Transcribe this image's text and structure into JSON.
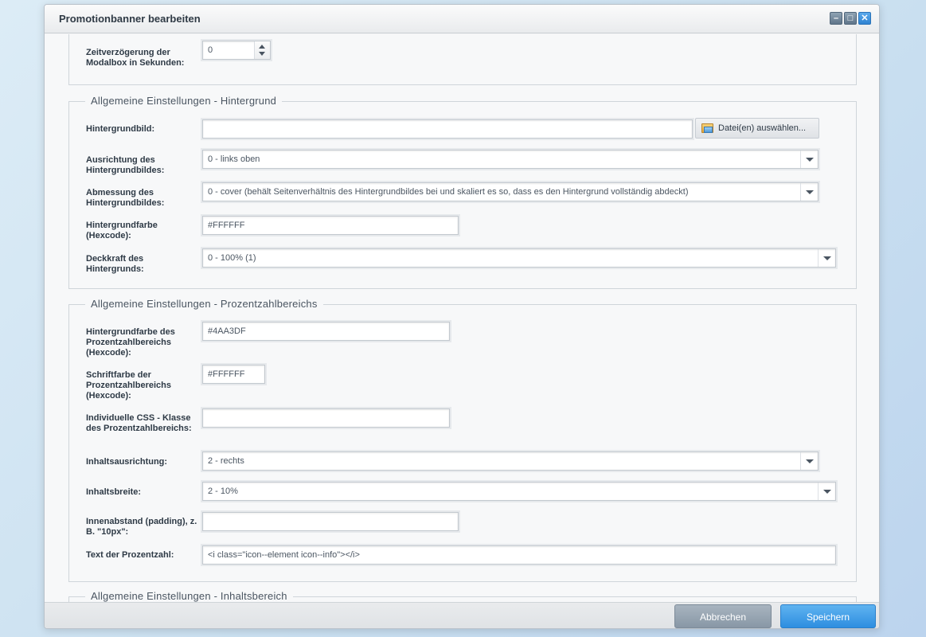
{
  "window": {
    "title": "Promotionbanner bearbeiten",
    "controls": {
      "minimize": "–",
      "maximize": "□",
      "close": "✕"
    }
  },
  "top_section": {
    "delay_label": "Zeitverzögerung der Modalbox in Sekunden:",
    "delay_value": "0"
  },
  "background_section": {
    "legend": "Allgemeine Einstellungen - Hintergrund",
    "image_label": "Hintergrundbild:",
    "image_value": "",
    "file_button": "Datei(en) auswählen...",
    "alignment_label": "Ausrichtung des Hintergrundbildes:",
    "alignment_value": "0 - links oben",
    "size_label": "Abmessung des Hintergrundbildes:",
    "size_value": "0 - cover (behält Seitenverhältnis des Hintergrundbildes bei und skaliert es so, dass es den Hintergrund vollständig abdeckt)",
    "color_label": "Hintergrundfarbe (Hexcode):",
    "color_value": "#FFFFFF",
    "opacity_label": "Deckkraft des Hintergrunds:",
    "opacity_value": "0 - 100% (1)"
  },
  "percent_section": {
    "legend": "Allgemeine Einstellungen - Prozentzahlbereichs",
    "bg_color_label": "Hintergrundfarbe des Prozentzahlbereichs (Hexcode):",
    "bg_color_value": "#4AA3DF",
    "font_color_label": "Schriftfarbe der Prozentzahlbereichs (Hexcode):",
    "font_color_value": "#FFFFFF",
    "css_class_label": "Individuelle CSS - Klasse des Prozentzahlbereichs:",
    "css_class_value": "",
    "content_align_label": "Inhaltsausrichtung:",
    "content_align_value": "2 - rechts",
    "content_width_label": "Inhaltsbreite:",
    "content_width_value": "2 - 10%",
    "padding_label": "Innenabstand (padding), z. B. \"10px\":",
    "padding_value": "",
    "percent_text_label": "Text der Prozentzahl:",
    "percent_text_value": "<i class=\"icon--element icon--info\"></i>"
  },
  "content_section": {
    "legend": "Allgemeine Einstellungen - Inhaltsbereich"
  },
  "footer": {
    "cancel_label": "Abbrechen",
    "save_label": "Speichern"
  },
  "colors": {
    "save_button": "#3d9ee6",
    "cancel_button": "#97a5b3"
  }
}
